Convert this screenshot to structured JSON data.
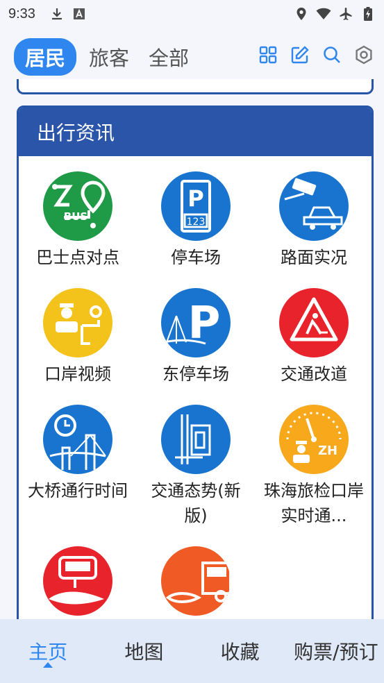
{
  "status": {
    "time": "9:33"
  },
  "header": {
    "tabs": [
      {
        "label": "居民",
        "active": true
      },
      {
        "label": "旅客",
        "active": false
      },
      {
        "label": "全部",
        "active": false
      }
    ]
  },
  "card": {
    "title": "出行资讯",
    "items": [
      {
        "label": "巴士点对点",
        "icon": "bus-route-icon",
        "color": "#1f9a46"
      },
      {
        "label": "停车场",
        "icon": "parking-123-icon",
        "color": "#1874cf"
      },
      {
        "label": "路面实况",
        "icon": "traffic-camera-icon",
        "color": "#1874cf"
      },
      {
        "label": "口岸视频",
        "icon": "port-officer-icon",
        "color": "#f3c21b"
      },
      {
        "label": "东停车场",
        "icon": "bridge-parking-icon",
        "color": "#1874cf"
      },
      {
        "label": "交通改道",
        "icon": "roadwork-icon",
        "color": "#e8232b"
      },
      {
        "label": "大桥通行时间",
        "icon": "bridge-clock-icon",
        "color": "#1874cf"
      },
      {
        "label": "交通态势(新版)",
        "icon": "traffic-map-icon",
        "color": "#1874cf"
      },
      {
        "label": "珠海旅检口岸实时通...",
        "icon": "gauge-officer-icon",
        "color": "#f7a81b"
      },
      {
        "label": "",
        "icon": "bus-ticket-icon",
        "color": "#e8232b"
      },
      {
        "label": "",
        "icon": "truck-icon",
        "color": "#f05a24"
      }
    ]
  },
  "bottom_nav": [
    {
      "label": "主页",
      "active": true
    },
    {
      "label": "地图",
      "active": false
    },
    {
      "label": "收藏",
      "active": false
    },
    {
      "label": "购票/预订",
      "active": false
    }
  ]
}
